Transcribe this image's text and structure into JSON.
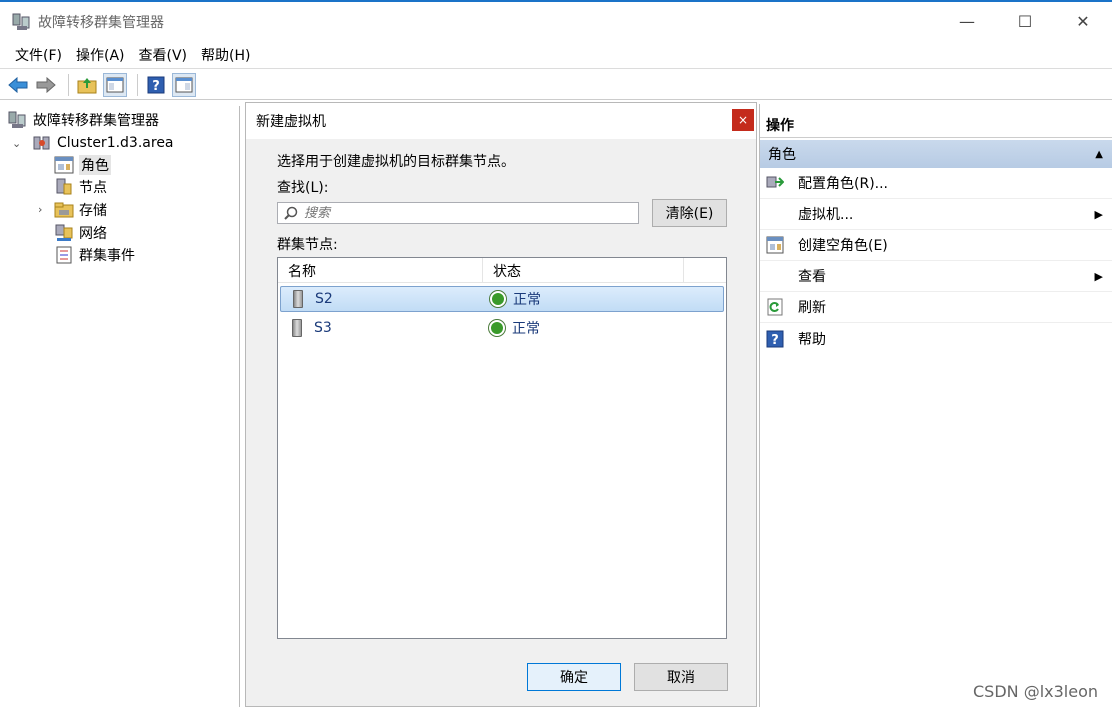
{
  "window": {
    "title": "故障转移群集管理器",
    "minimize": "—",
    "maximize": "☐",
    "close": "✕"
  },
  "menu": [
    {
      "label": "文件(F)"
    },
    {
      "label": "操作(A)"
    },
    {
      "label": "查看(V)"
    },
    {
      "label": "帮助(H)"
    }
  ],
  "tree": {
    "root": "故障转移群集管理器",
    "cluster": "Cluster1.d3.area",
    "children": [
      "角色",
      "节点",
      "存储",
      "网络",
      "群集事件"
    ]
  },
  "dialog": {
    "title": "新建虚拟机",
    "close": "×",
    "instruction": "选择用于创建虚拟机的目标群集节点。",
    "search_label": "查找(L):",
    "search_placeholder": "搜索",
    "clear_button": "清除(E)",
    "nodes_label": "群集节点:",
    "columns": [
      "名称",
      "状态"
    ],
    "rows": [
      {
        "name": "S2",
        "status": "正常"
      },
      {
        "name": "S3",
        "status": "正常"
      }
    ],
    "ok_button": "确定",
    "cancel_button": "取消"
  },
  "actions": {
    "header": "操作",
    "section": "角色",
    "items": [
      {
        "label": "配置角色(R)..."
      },
      {
        "label": "虚拟机..."
      },
      {
        "label": "创建空角色(E)"
      },
      {
        "label": "查看"
      },
      {
        "label": "刷新"
      },
      {
        "label": "帮助"
      }
    ]
  },
  "watermark": "CSDN @lx3leon"
}
